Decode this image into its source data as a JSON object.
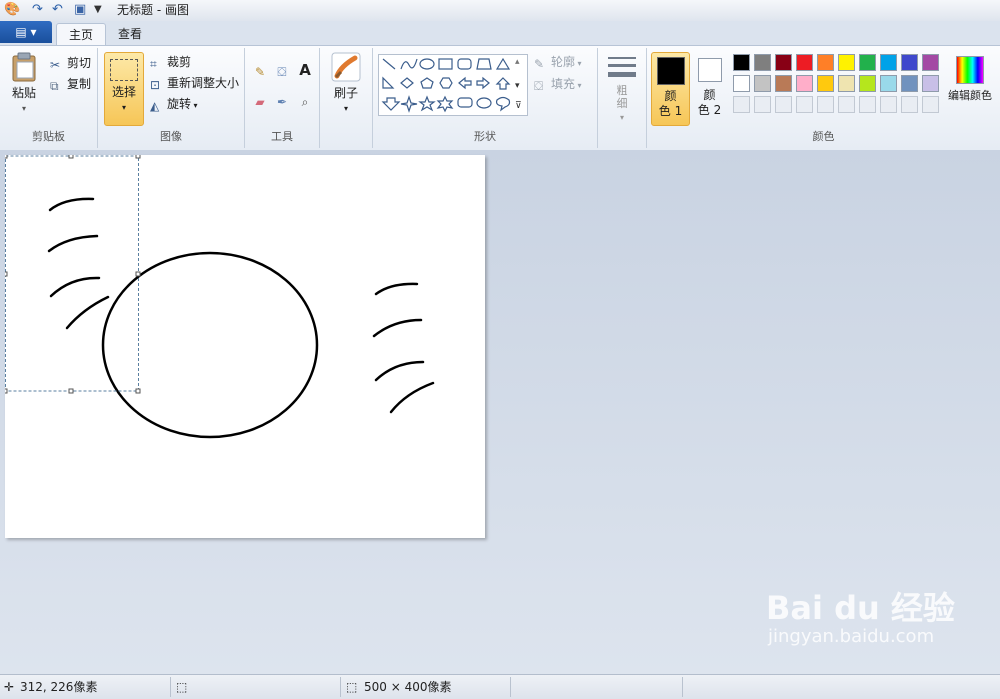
{
  "window": {
    "title": "无标题 - 画图"
  },
  "tabs": [
    {
      "label": "主页",
      "active": true
    },
    {
      "label": "查看",
      "active": false
    }
  ],
  "clipboard": {
    "paste": "粘贴",
    "cut": "剪切",
    "copy": "复制",
    "label": "剪贴板"
  },
  "image": {
    "select": "选择",
    "crop": "裁剪",
    "resize": "重新调整大小",
    "rotate": "旋转",
    "label": "图像"
  },
  "tools": {
    "label": "工具",
    "text_glyph": "A"
  },
  "brushes": {
    "label": "刷子"
  },
  "shapes": {
    "outline": "轮廓",
    "fill": "填充",
    "label": "形状"
  },
  "size": {
    "label": "粗\n细"
  },
  "colors": {
    "color1": "颜\n色 1",
    "color2": "颜\n色 2",
    "edit": "编辑颜色",
    "label": "颜色",
    "color1_value": "#000000",
    "color2_value": "#ffffff",
    "palette_row1": [
      "#000000",
      "#7f7f7f",
      "#880015",
      "#ed1c24",
      "#ff7f27",
      "#fff200",
      "#22b14c",
      "#00a2e8",
      "#3f48cc",
      "#a349a4"
    ],
    "palette_row2": [
      "#ffffff",
      "#c3c3c3",
      "#b97a57",
      "#ffaec9",
      "#ffc90e",
      "#efe4b0",
      "#b5e61d",
      "#99d9ea",
      "#7092be",
      "#c8bfe7"
    ]
  },
  "status": {
    "cursor_pos": "312, 226像素",
    "canvas_size": "500 × 400像素"
  },
  "watermark": {
    "brand": "Bai du 经验",
    "url": "jingyan.baidu.com"
  }
}
